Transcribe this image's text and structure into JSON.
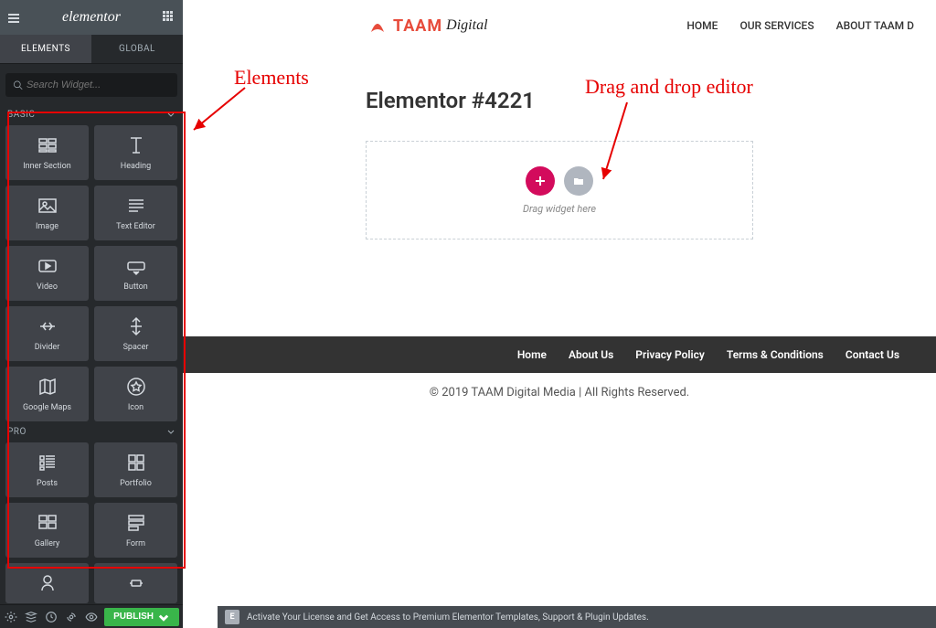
{
  "sidebar": {
    "logo": "elementor",
    "tabs": {
      "elements": "ELEMENTS",
      "global": "GLOBAL"
    },
    "search_placeholder": "Search Widget...",
    "sections": {
      "basic": "BASIC",
      "pro": "PRO"
    },
    "widgets_basic": [
      {
        "name": "Inner Section"
      },
      {
        "name": "Heading"
      },
      {
        "name": "Image"
      },
      {
        "name": "Text Editor"
      },
      {
        "name": "Video"
      },
      {
        "name": "Button"
      },
      {
        "name": "Divider"
      },
      {
        "name": "Spacer"
      },
      {
        "name": "Google Maps"
      },
      {
        "name": "Icon"
      }
    ],
    "widgets_pro": [
      {
        "name": "Posts"
      },
      {
        "name": "Portfolio"
      },
      {
        "name": "Gallery"
      },
      {
        "name": "Form"
      }
    ],
    "footer": {
      "publish": "PUBLISH"
    }
  },
  "site": {
    "brand1": "TAAM",
    "brand2": "Digital",
    "nav": [
      "HOME",
      "OUR SERVICES",
      "ABOUT TAAM D"
    ]
  },
  "page": {
    "title": "Elementor #4221",
    "drop_hint": "Drag widget here"
  },
  "footer_nav": [
    "Home",
    "About Us",
    "Privacy Policy",
    "Terms & Conditions",
    "Contact Us"
  ],
  "copyright": "© 2019 TAAM Digital Media | All Rights Reserved.",
  "license_bar": {
    "badge": "E",
    "text": "Activate Your License and Get Access to Premium Elementor Templates, Support & Plugin Updates."
  },
  "annotations": {
    "elements": "Elements",
    "editor": "Drag and drop editor"
  }
}
